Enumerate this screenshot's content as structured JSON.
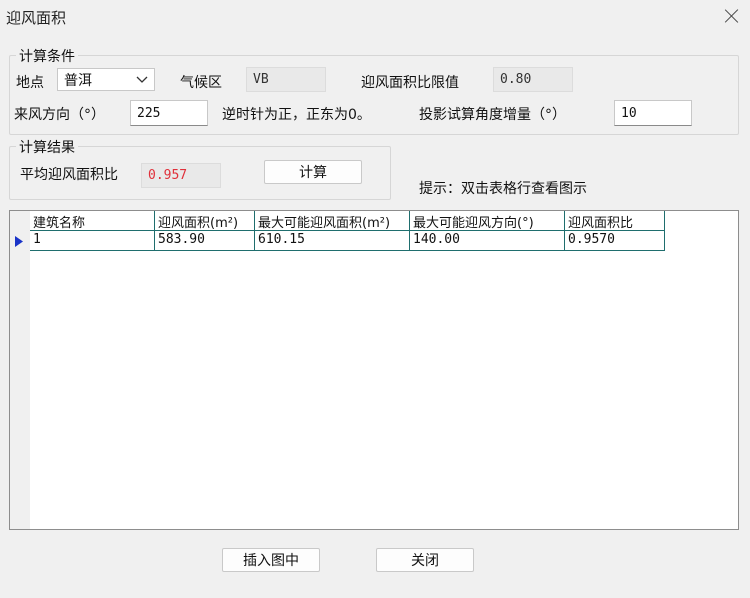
{
  "window": {
    "title": "迎风面积"
  },
  "conditions": {
    "legend": "计算条件",
    "location_label": "地点",
    "location_value": "普洱",
    "climate_label": "气候区",
    "climate_value": "VB",
    "ratio_limit_label": "迎风面积比限值",
    "ratio_limit_value": "0.80",
    "wind_dir_label": "来风方向（°）",
    "wind_dir_value": "225",
    "wind_dir_hint": "逆时针为正，正东为0。",
    "angle_step_label": "投影试算角度增量（°）",
    "angle_step_value": "10"
  },
  "results": {
    "legend": "计算结果",
    "avg_ratio_label": "平均迎风面积比",
    "avg_ratio_value": "0.957",
    "calc_button": "计算"
  },
  "hint": "提示：双击表格行查看图示",
  "table": {
    "columns": [
      "建筑名称",
      "迎风面积(m²)",
      "最大可能迎风面积(m²)",
      "最大可能迎风方向(°)",
      "迎风面积比"
    ],
    "rows": [
      [
        "1",
        "583.90",
        "610.15",
        "140.00",
        "0.9570"
      ]
    ]
  },
  "buttons": {
    "insert": "插入图中",
    "close": "关闭"
  },
  "colors": {
    "accent_red": "#e0303a",
    "grid_line": "#1f6e6e",
    "row_indicator": "#1a34c8"
  }
}
